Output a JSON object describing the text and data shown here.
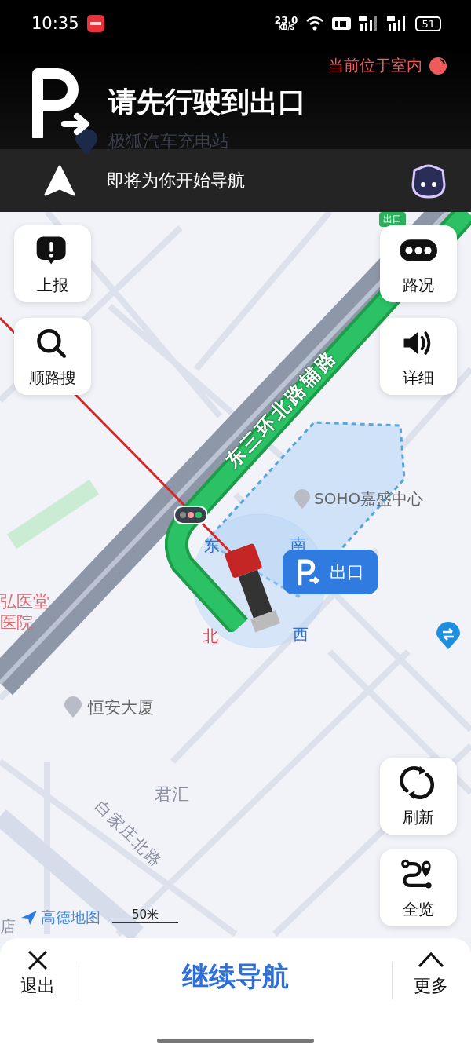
{
  "status_bar": {
    "time": "10:35",
    "net_speed": "23.0",
    "net_unit": "KB/S",
    "battery": "51"
  },
  "header": {
    "indoor_notice": "当前位于室内",
    "instruction": "请先行驶到出口",
    "subtitle": "即将为你开始导航"
  },
  "map": {
    "charging_station": "极狐汽车充电站",
    "exit_tag": "出口",
    "main_road": "东三环北路辅路",
    "soho": "SOHO嘉盛中心",
    "compass": [
      {
        "label": "东",
        "color": "#2f6fd0"
      },
      {
        "label": "南",
        "color": "#2f6fd0"
      },
      {
        "label": "北",
        "color": "#e0464e"
      },
      {
        "label": "西",
        "color": "#2f6fd0"
      }
    ],
    "exit_bubble": "出口",
    "hospital": [
      "弘医堂",
      "医院"
    ],
    "hengan": "恒安大厦",
    "district": "君汇",
    "side_road": "白家庄北路",
    "brand": "高德地图",
    "scale": "50米",
    "edge_label": "店"
  },
  "left_buttons": [
    {
      "kind": "report",
      "label": "上报"
    },
    {
      "kind": "search",
      "label": "顺路搜"
    }
  ],
  "right_buttons": [
    {
      "kind": "traffic",
      "label": "路况"
    },
    {
      "kind": "sound",
      "label": "详细"
    },
    {
      "kind": "refresh",
      "label": "刷新"
    },
    {
      "kind": "overview",
      "label": "全览"
    }
  ],
  "bottom_bar": {
    "exit": "退出",
    "primary": "继续导航",
    "more": "更多"
  }
}
